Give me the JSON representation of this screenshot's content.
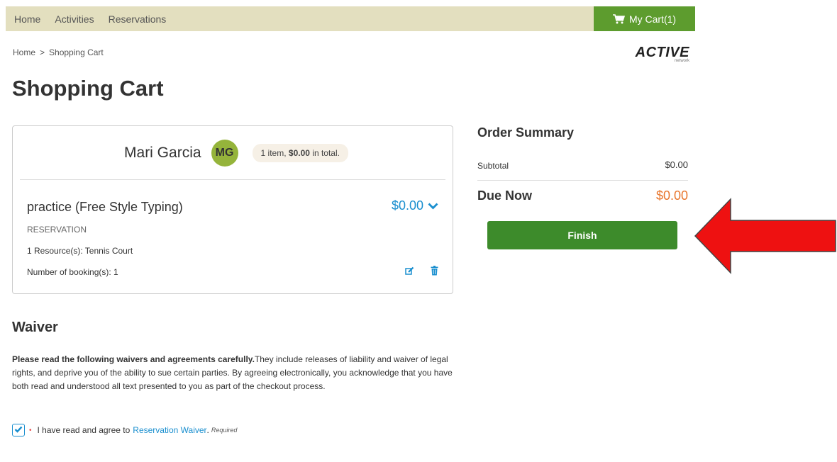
{
  "nav": {
    "items": [
      "Home",
      "Activities",
      "Reservations"
    ],
    "cart_label": "My Cart(1)"
  },
  "breadcrumb": {
    "home": "Home",
    "separator": ">",
    "current": "Shopping Cart"
  },
  "logo": {
    "word": "ACTIVE",
    "sub": "network"
  },
  "page_title": "Shopping Cart",
  "cart": {
    "participant_name": "Mari Garcia",
    "avatar_initials": "MG",
    "summary_prefix": "1 item, ",
    "summary_amount": "$0.00",
    "summary_suffix": " in total.",
    "item": {
      "title": "practice (Free Style Typing)",
      "price": "$0.00",
      "type": "RESERVATION",
      "resource": "1 Resource(s): Tennis Court",
      "bookings": "Number of booking(s): 1"
    }
  },
  "order_summary": {
    "title": "Order Summary",
    "subtotal_label": "Subtotal",
    "subtotal_value": "$0.00",
    "due_label": "Due Now",
    "due_value": "$0.00",
    "finish_label": "Finish"
  },
  "waiver": {
    "title": "Waiver",
    "lead": "Please read the following waivers and agreements carefully.",
    "body": "They include releases of liability and waiver of legal rights, and deprive you of the ability to sue certain parties. By agreeing electronically, you acknowledge that you have both read and understood all text presented to you as part of the checkout process.",
    "agree_prefix": "I have read and agree to",
    "agree_link": "Reservation Waiver",
    "required": "Required",
    "checked": true
  },
  "colors": {
    "nav_bg": "#e3dfbf",
    "cart_green": "#5d9c2e",
    "finish_green": "#3d8b2b",
    "price_blue": "#1a8fcf",
    "due_orange": "#e8762d",
    "arrow_red": "#ee1111"
  }
}
